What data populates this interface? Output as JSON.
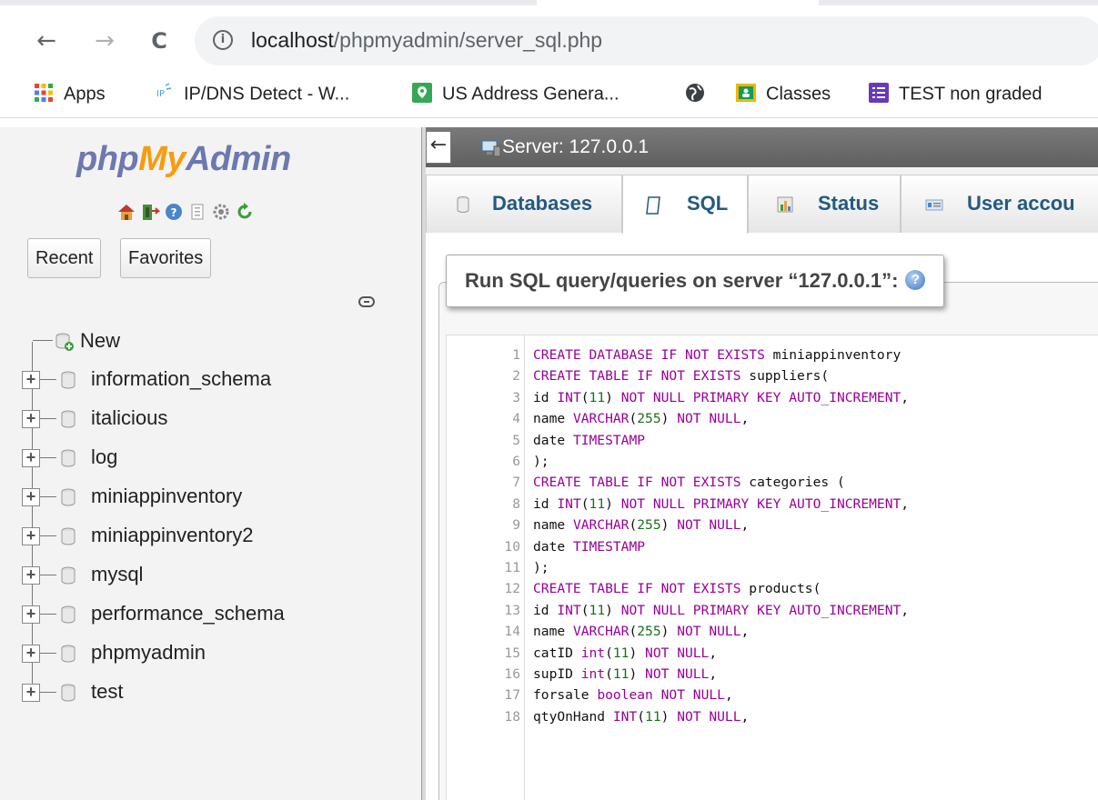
{
  "browser": {
    "url_host": "localhost",
    "url_path": "/phpmyadmin/server_sql.php",
    "back_glyph": "←",
    "forward_glyph": "→",
    "reload_glyph": "C",
    "info_glyph": "i",
    "bookmarks": [
      {
        "label": "Apps",
        "icon": "apps-grid-icon"
      },
      {
        "label": "IP/DNS Detect - W...",
        "icon": "ip-dns-icon"
      },
      {
        "label": "US Address Genera...",
        "icon": "map-pin-icon"
      },
      {
        "label": "",
        "icon": "globe-icon"
      },
      {
        "label": "Classes",
        "icon": "classroom-icon"
      },
      {
        "label": "TEST non graded",
        "icon": "form-list-icon"
      }
    ]
  },
  "nav": {
    "logo_php": "php",
    "logo_my": "My",
    "logo_admin": "Admin",
    "recent_label": "Recent",
    "favorites_label": "Favorites",
    "new_label": "New",
    "databases": [
      "information_schema",
      "italicious",
      "log",
      "miniappinventory",
      "miniappinventory2",
      "mysql",
      "performance_schema",
      "phpmyadmin",
      "test"
    ],
    "expander_glyph": "+",
    "collapse_glyph": "←"
  },
  "main": {
    "server_label": "Server: 127.0.0.1",
    "tabs": [
      {
        "label": "Databases",
        "icon": "database-icon"
      },
      {
        "label": "SQL",
        "icon": "sql-icon",
        "active": true
      },
      {
        "label": "Status",
        "icon": "status-chart-icon"
      },
      {
        "label": "User accou",
        "icon": "user-accounts-icon"
      }
    ],
    "query_title": "Run SQL query/queries on server “127.0.0.1”:",
    "help_glyph": "?"
  },
  "sql_lines": [
    {
      "n": "1",
      "text": "CREATE DATABASE IF NOT EXISTS miniappinventory"
    },
    {
      "n": "2",
      "text": "CREATE TABLE IF NOT EXISTS suppliers("
    },
    {
      "n": "3",
      "text": "id INT(11) NOT NULL PRIMARY KEY AUTO_INCREMENT,"
    },
    {
      "n": "4",
      "text": "name VARCHAR(255) NOT NULL,"
    },
    {
      "n": "5",
      "text": "date TIMESTAMP"
    },
    {
      "n": "6",
      "text": ");"
    },
    {
      "n": "7",
      "text": "CREATE TABLE IF NOT EXISTS categories ("
    },
    {
      "n": "8",
      "text": "id INT(11) NOT NULL PRIMARY KEY AUTO_INCREMENT,"
    },
    {
      "n": "9",
      "text": "name VARCHAR(255) NOT NULL,"
    },
    {
      "n": "10",
      "text": "date TIMESTAMP"
    },
    {
      "n": "11",
      "text": ");"
    },
    {
      "n": "12",
      "text": "CREATE TABLE IF NOT EXISTS products("
    },
    {
      "n": "13",
      "text": "id INT(11) NOT NULL PRIMARY KEY AUTO_INCREMENT,"
    },
    {
      "n": "14",
      "text": "name VARCHAR(255) NOT NULL,"
    },
    {
      "n": "15",
      "text": "catID int(11) NOT NULL,"
    },
    {
      "n": "16",
      "text": "supID int(11) NOT NULL,"
    },
    {
      "n": "17",
      "text": "forsale boolean NOT NULL,"
    },
    {
      "n": "18",
      "text": "qtyOnHand INT(11) NOT NULL,"
    }
  ],
  "colors": {
    "logo_blue": "#6c78af",
    "logo_orange": "#f89c0e",
    "tab_text": "#235a81",
    "sql_keyword": "#990099",
    "sql_number": "#1a6e1a"
  }
}
